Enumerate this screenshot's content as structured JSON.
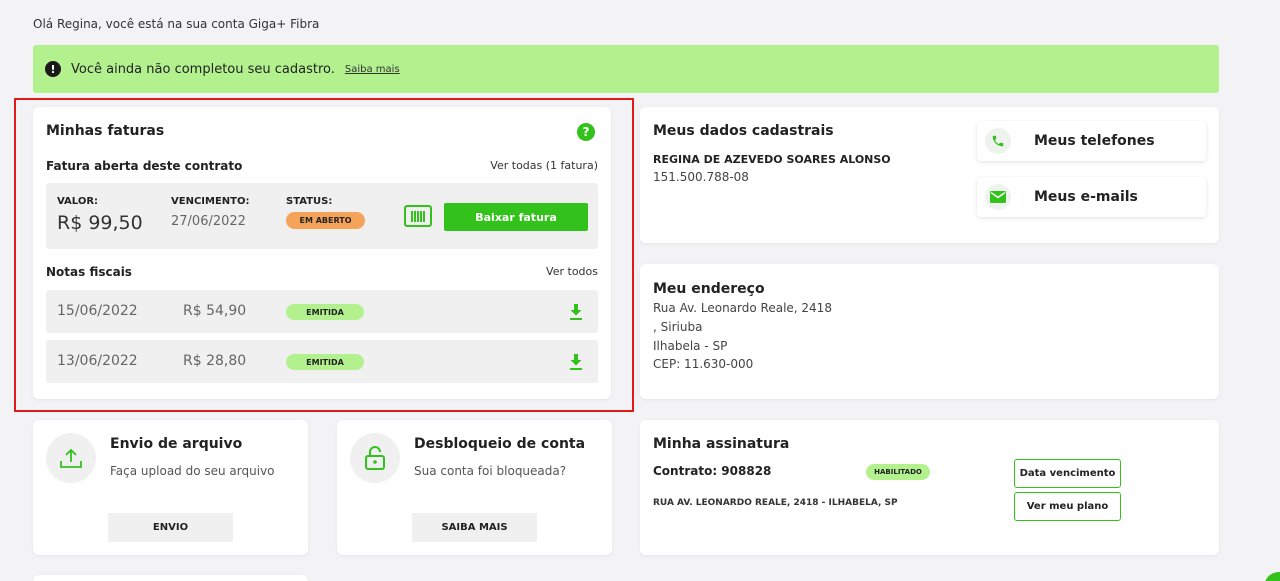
{
  "greeting": "Olá Regina, você está na sua conta Giga+ Fibra",
  "alert": {
    "message": "Você ainda não completou seu cadastro.",
    "link": "Saiba mais",
    "icon": "exclamation-icon"
  },
  "faturas": {
    "title": "Minhas faturas",
    "subtitle": "Fatura aberta deste contrato",
    "ver_todas": "Ver todas (1 fatura)",
    "invoice": {
      "valor_label": "VALOR:",
      "valor": "R$ 99,50",
      "vencimento_label": "VENCIMENTO:",
      "vencimento": "27/06/2022",
      "status_label": "STATUS:",
      "status": "EM ABERTO",
      "baixar": "Baixar fatura"
    },
    "notas_title": "Notas fiscais",
    "notas_ver_todos": "Ver todos",
    "notas": [
      {
        "date": "15/06/2022",
        "value": "R$ 54,90",
        "status": "EMITIDA"
      },
      {
        "date": "13/06/2022",
        "value": "R$ 28,80",
        "status": "EMITIDA"
      }
    ]
  },
  "dados": {
    "title": "Meus dados cadastrais",
    "name": "REGINA DE AZEVEDO SOARES ALONSO",
    "document": "151.500.788-08",
    "telefones": "Meus telefones",
    "emails": "Meus e-mails"
  },
  "endereco": {
    "title": "Meu endereço",
    "line1": "Rua Av. Leonardo Reale, 2418",
    "line2": ", Siriuba",
    "line3": "Ilhabela - SP",
    "line4": "CEP: 11.630-000"
  },
  "envio": {
    "title": "Envio de arquivo",
    "desc": "Faça upload do seu arquivo",
    "button": "ENVIO"
  },
  "desbloqueio": {
    "title": "Desbloqueio de conta",
    "desc": "Sua conta foi bloqueada?",
    "button": "SAIBA MAIS"
  },
  "assinatura": {
    "title": "Minha assinatura",
    "contrato": "Contrato: 908828",
    "status": "HABILITADO",
    "address": "RUA AV. LEONARDO REALE, 2418 - ILHABELA, SP",
    "data_vencimento": "Data vencimento",
    "ver_plano": "Ver meu plano"
  },
  "colors": {
    "accent": "#33c21b",
    "alert_bg": "#b3f18f",
    "badge_open": "#f6a35a",
    "highlight": "#e01b1b"
  }
}
